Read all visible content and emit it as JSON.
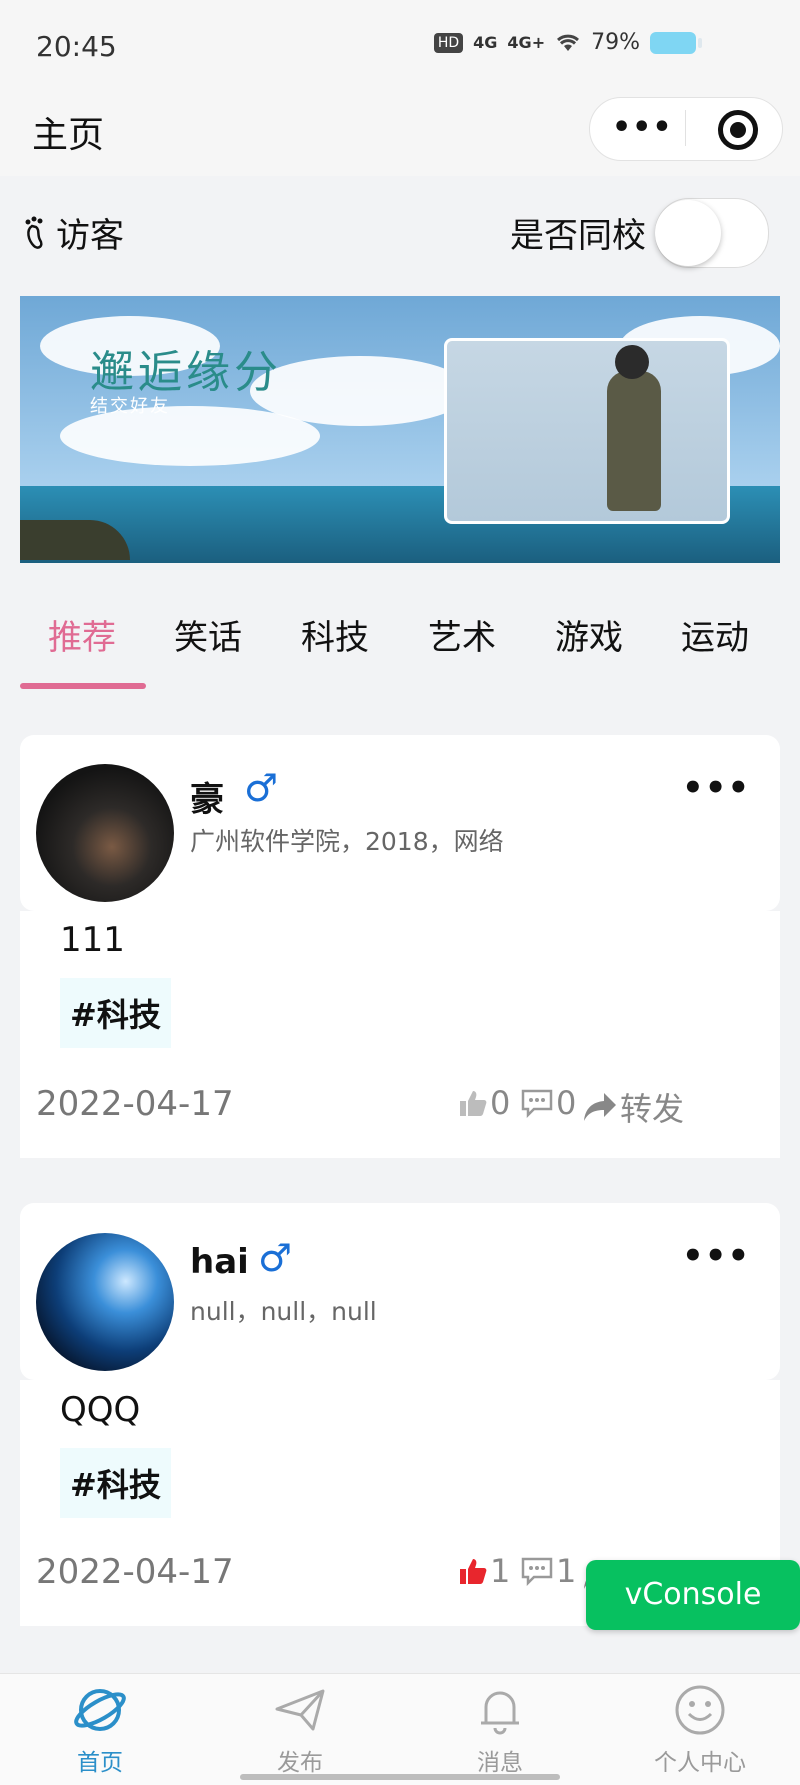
{
  "status_bar": {
    "time": "20:45",
    "network1": "HD",
    "network2": "4G",
    "network3": "4G+",
    "battery": "79%"
  },
  "nav": {
    "title": "主页"
  },
  "filters": {
    "visitor_label": "访客",
    "same_school_label": "是否同校",
    "same_school_on": false
  },
  "banner": {
    "title": "邂逅缘分",
    "subtitle": "结交好友"
  },
  "tabs": [
    {
      "label": "推荐",
      "active": true
    },
    {
      "label": "笑话"
    },
    {
      "label": "科技"
    },
    {
      "label": "艺术"
    },
    {
      "label": "游戏"
    },
    {
      "label": "运动"
    }
  ],
  "posts": [
    {
      "name": "豪",
      "gender_symbol": "♂",
      "info": "广州软件学院，2018，网络",
      "content": "111",
      "tag": "#科技",
      "date": "2022-04-17",
      "likes": "0",
      "comments": "0",
      "share_label": "转发",
      "liked": false
    },
    {
      "name": "hai",
      "gender_symbol": "♂",
      "info": "null，null，null",
      "content": "QQQ",
      "tag": "#科技",
      "date": "2022-04-17",
      "likes": "1",
      "comments": "1",
      "share_label": "转发",
      "liked": true
    }
  ],
  "vconsole": "vConsole",
  "tabbar": [
    {
      "label": "首页",
      "active": true
    },
    {
      "label": "发布"
    },
    {
      "label": "消息"
    },
    {
      "label": "个人中心"
    }
  ],
  "colors": {
    "accent": "#e06b93",
    "tab_active": "#2b8fc9",
    "like": "#e8262d",
    "vconsole": "#07c160"
  }
}
